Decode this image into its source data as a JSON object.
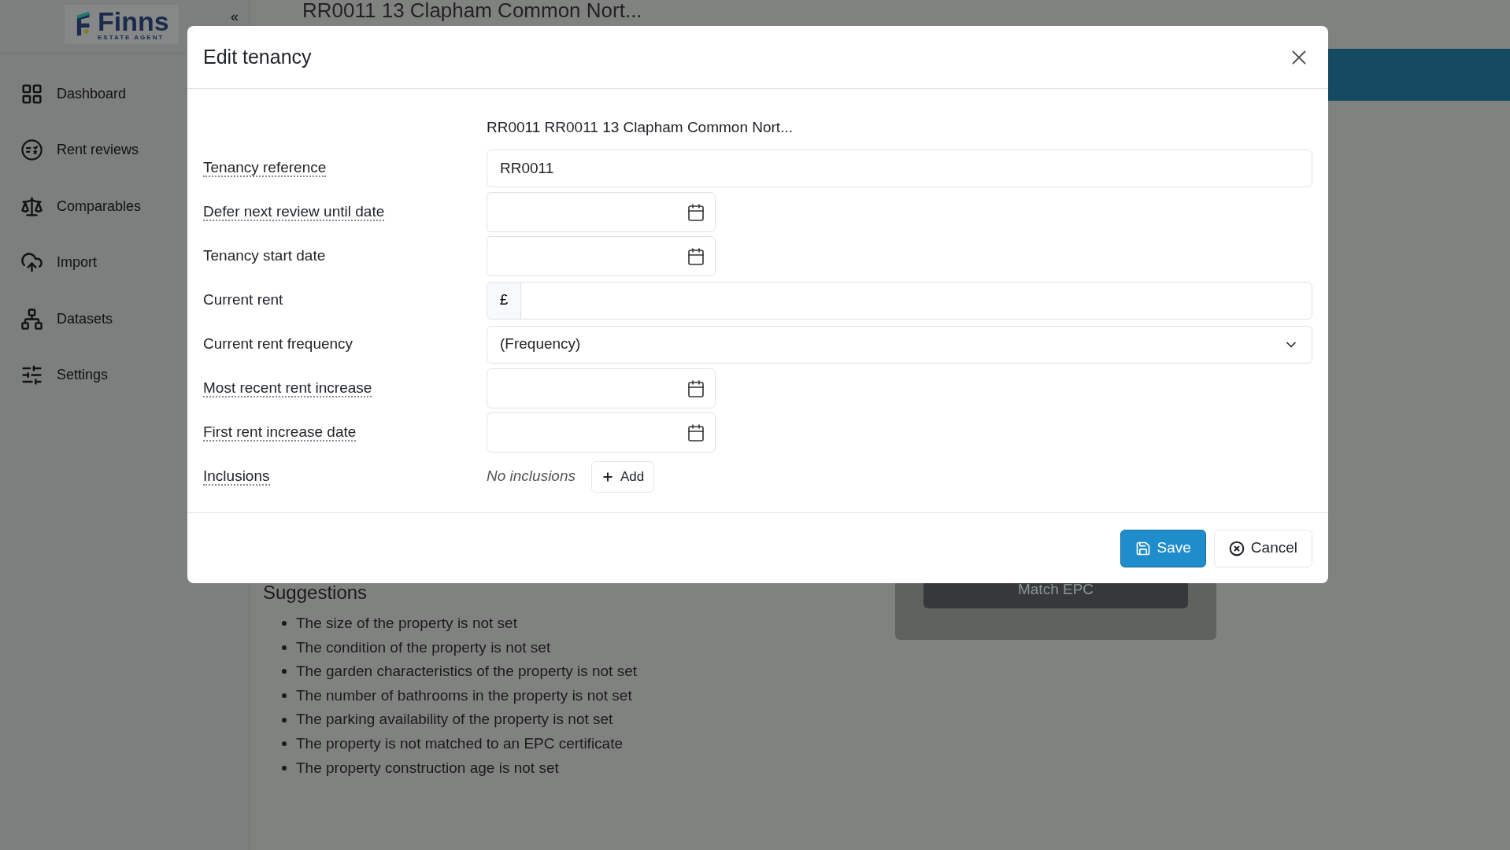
{
  "sidebar": {
    "logo": {
      "name": "Finns",
      "tagline": "ESTATE AGENT"
    },
    "collapse": "«",
    "items": [
      {
        "label": "Dashboard"
      },
      {
        "label": "Rent reviews"
      },
      {
        "label": "Comparables"
      },
      {
        "label": "Import"
      },
      {
        "label": "Datasets"
      },
      {
        "label": "Settings"
      }
    ]
  },
  "page": {
    "title": "RR0011 13 Clapham Common Nort...",
    "suggestions": {
      "title": "Suggestions",
      "items": [
        "The size of the property is not set",
        "The condition of the property is not set",
        "The garden characteristics of the property is not set",
        "The number of bathrooms in the property is not set",
        "The parking availability of the property is not set",
        "The property is not matched to an EPC certificate",
        "The property construction age is not set"
      ]
    },
    "epc_button": "Match EPC"
  },
  "dialog": {
    "title": "Edit tenancy",
    "property": "RR0011 RR0011 13 Clapham Common Nort...",
    "fields": [
      {
        "label": "Tenancy reference",
        "hint": true,
        "kind": "text",
        "value": "RR0011"
      },
      {
        "label": "Defer next review until date",
        "hint": true,
        "kind": "date"
      },
      {
        "label": "Tenancy start date",
        "hint": false,
        "kind": "date"
      },
      {
        "label": "Current rent",
        "hint": false,
        "kind": "currency",
        "prefix": "£"
      },
      {
        "label": "Current rent frequency",
        "hint": false,
        "kind": "select",
        "value": "(Frequency)"
      },
      {
        "label": "Most recent rent increase",
        "hint": true,
        "kind": "date"
      },
      {
        "label": "First rent increase date",
        "hint": true,
        "kind": "date"
      },
      {
        "label": "Inclusions",
        "hint": true,
        "kind": "inclusions",
        "empty_text": "No inclusions",
        "button": "Add"
      }
    ],
    "buttons": [
      {
        "label": "Save",
        "kind": "primary"
      },
      {
        "label": "Cancel",
        "kind": "secondary"
      }
    ]
  }
}
